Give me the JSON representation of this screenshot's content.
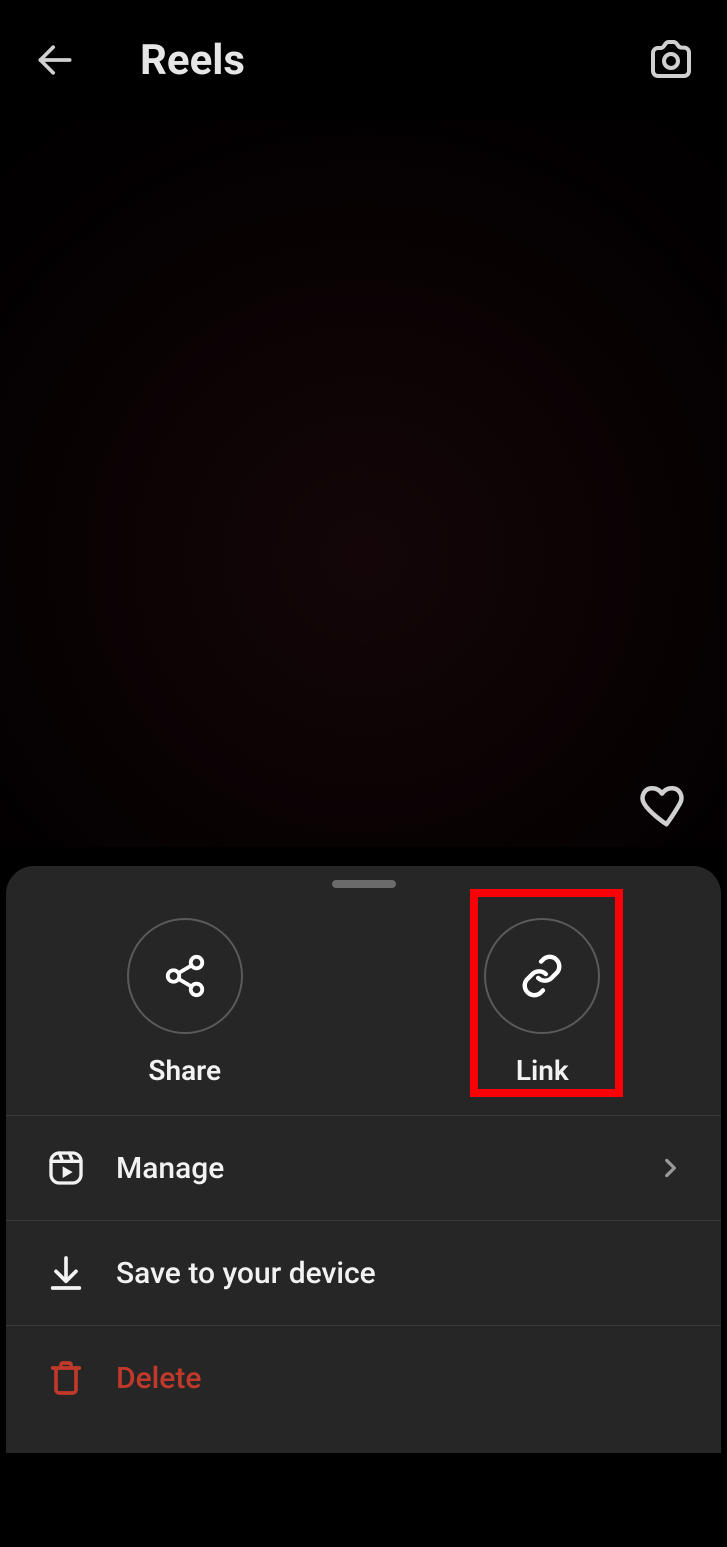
{
  "header": {
    "title": "Reels"
  },
  "sheet": {
    "share_label": "Share",
    "link_label": "Link",
    "rows": {
      "manage": "Manage",
      "save": "Save to your device",
      "delete": "Delete"
    }
  }
}
